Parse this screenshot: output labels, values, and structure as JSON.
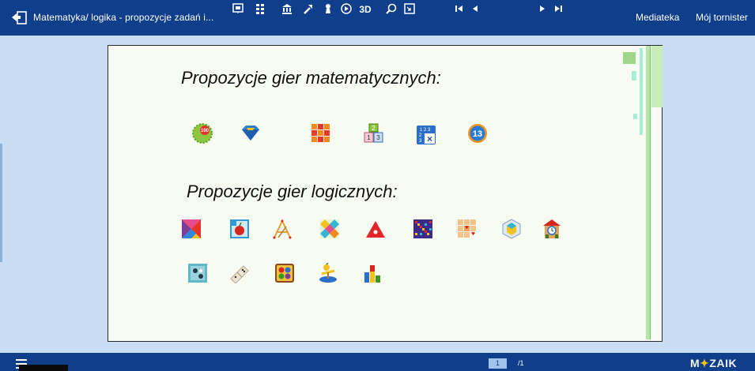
{
  "header": {
    "title": "Matematyka/ logika - propozycje zadań i...",
    "mediateka": "Mediateka",
    "tornister": "Mój tornister"
  },
  "slide": {
    "heading_math": "Propozycje gier matematycznych:",
    "heading_logic": "Propozycje gier logicznych:",
    "math_games": [
      "game-100-icon",
      "diamond-shape-icon",
      "grid-blocks-icon",
      "number-blocks-icon",
      "multiplication-table-icon",
      "number-13-icon"
    ],
    "logic_games_row1": [
      "tangram-icon",
      "apple-picture-icon",
      "sticks-icon",
      "color-tiles-icon",
      "red-triangle-icon",
      "colored-grid-icon",
      "hearts-grid-icon",
      "cube-view-icon",
      "clock-building-icon"
    ],
    "logic_games_row2": [
      "dots-tile-icon",
      "domino-icon",
      "color-balls-icon",
      "balance-icon",
      "bar-blocks-icon"
    ]
  },
  "footer": {
    "current_page": "1",
    "total_pages": "/1",
    "logo_left": "M",
    "logo_star": "✦",
    "logo_right": "ZAIK"
  }
}
